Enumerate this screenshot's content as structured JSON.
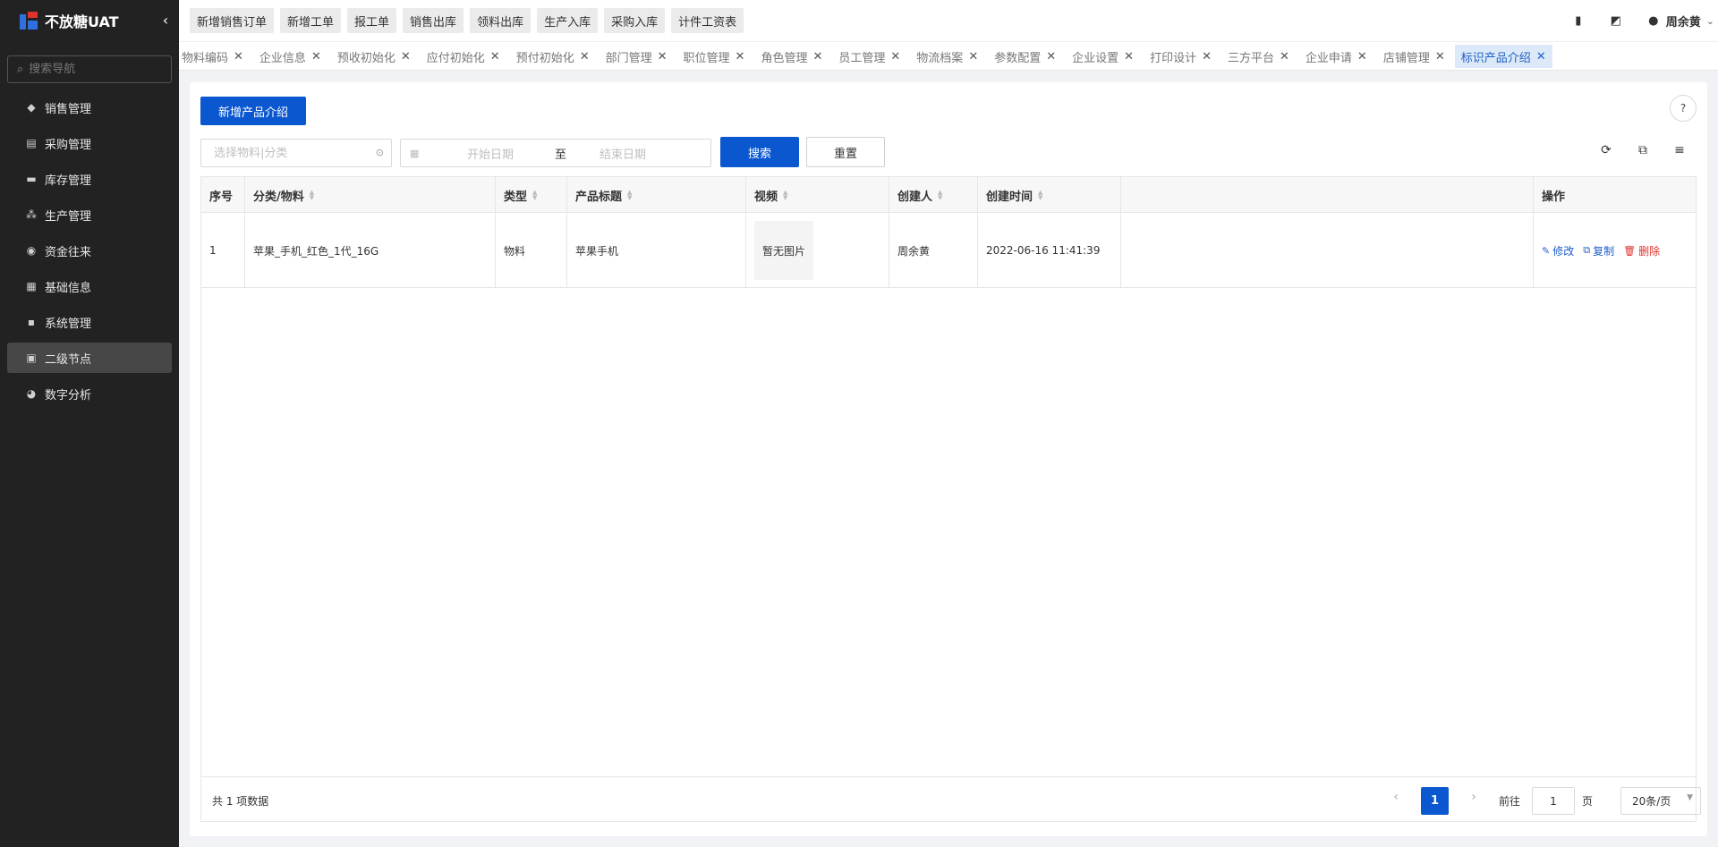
{
  "sidebar": {
    "app_title": "不放糖UAT",
    "collapse_icon": "chevron-left-icon",
    "search_placeholder": "搜索导航",
    "items": [
      {
        "label": "销售管理",
        "icon": "tag-icon"
      },
      {
        "label": "采购管理",
        "icon": "cart-icon"
      },
      {
        "label": "库存管理",
        "icon": "warehouse-icon"
      },
      {
        "label": "生产管理",
        "icon": "cluster-icon"
      },
      {
        "label": "资金往来",
        "icon": "money-icon"
      },
      {
        "label": "基础信息",
        "icon": "layout-icon"
      },
      {
        "label": "系统管理",
        "icon": "apps-icon"
      },
      {
        "label": "二级节点",
        "icon": "document-icon",
        "active": true
      },
      {
        "label": "数字分析",
        "icon": "pie-chart-icon"
      }
    ]
  },
  "topbar": {
    "quick_actions": [
      "新增销售订单",
      "新增工单",
      "报工单",
      "销售出库",
      "领料出库",
      "生产入库",
      "采购入库",
      "计件工资表"
    ],
    "user_name": "周余黄",
    "icons": [
      "mobile-icon",
      "chart-icon",
      "user-icon"
    ]
  },
  "tabs": {
    "items": [
      "物料编码",
      "企业信息",
      "预收初始化",
      "应付初始化",
      "预付初始化",
      "部门管理",
      "职位管理",
      "角色管理",
      "员工管理",
      "物流档案",
      "参数配置",
      "企业设置",
      "打印设计",
      "三方平台",
      "企业申请",
      "店铺管理",
      "标识产品介绍"
    ],
    "active_index": 16
  },
  "toolbar": {
    "add_label": "新增产品介绍",
    "help_label": "?"
  },
  "filters": {
    "material_placeholder": "选择物料|分类",
    "start_placeholder": "开始日期",
    "range_separator": "至",
    "end_placeholder": "结束日期",
    "search_label": "搜索",
    "reset_label": "重置"
  },
  "table": {
    "columns": [
      "序号",
      "分类/物料",
      "类型",
      "产品标题",
      "视频",
      "创建人",
      "创建时间",
      "",
      "操作"
    ],
    "rows": [
      {
        "index": "1",
        "material": "苹果_手机_红色_1代_16G",
        "type": "物料",
        "title": "苹果手机",
        "video": "暂无图片",
        "creator": "周余黄",
        "created_at": "2022-06-16 11:41:39",
        "actions": {
          "edit": "修改",
          "copy": "复制",
          "delete": "删除"
        }
      }
    ]
  },
  "pagination": {
    "total_text": "共 1 项数据",
    "current_page": "1",
    "goto_label": "前往",
    "goto_value": "1",
    "page_suffix": "页",
    "page_size": "20条/页"
  },
  "colors": {
    "primary": "#0b57d0",
    "sidebar_bg": "#222222",
    "danger": "#e0322f"
  }
}
